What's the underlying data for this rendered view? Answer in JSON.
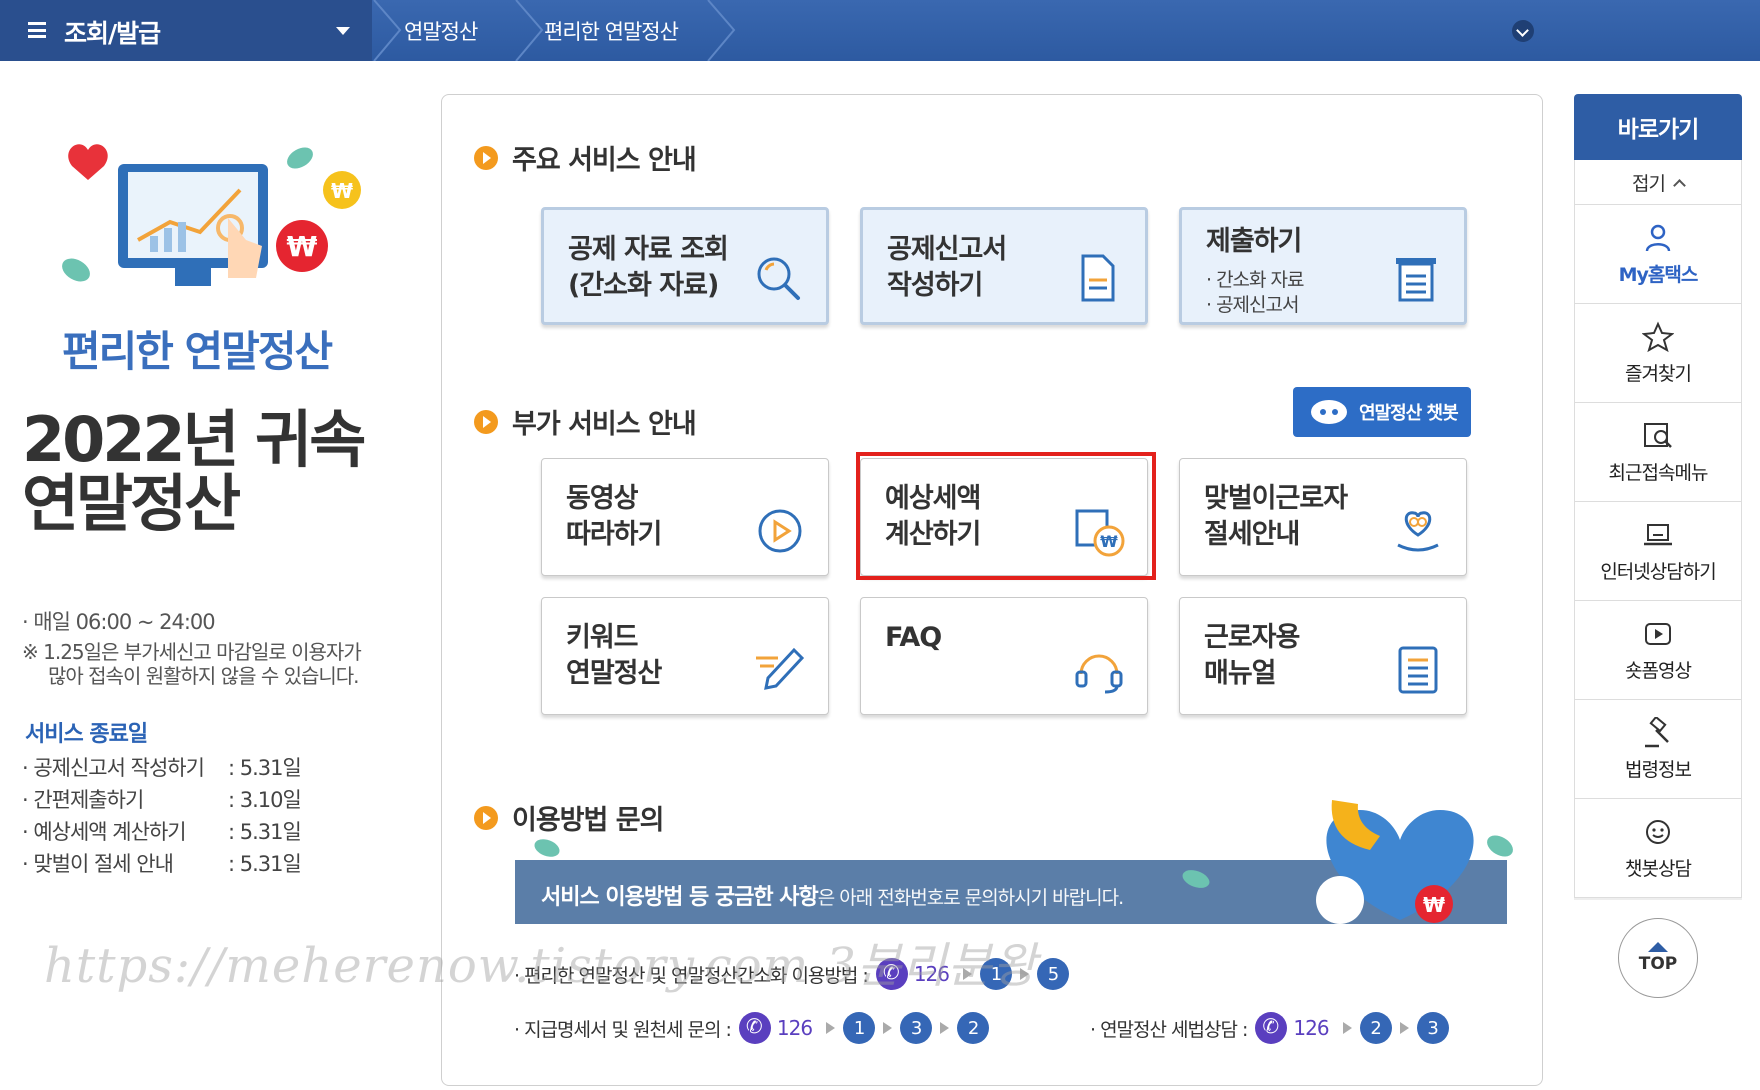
{
  "header": {
    "menu_title": "조회/발급",
    "breadcrumbs": [
      "연말정산",
      "편리한 연말정산"
    ]
  },
  "left": {
    "promo_title": "편리한 연말정산",
    "big_title_line1": "2022년 귀속",
    "big_title_line2": "연말정산",
    "hours": "· 매일 06:00  ~ 24:00",
    "notice_line1": "※ 1.25일은 부가세신고 마감일로 이용자가",
    "notice_line2": "많아 접속이 원활하지 않을 수 있습니다.",
    "end_title": "서비스 종료일",
    "end_items": [
      {
        "name": "· 공제신고서 작성하기",
        "date": ": 5.31일"
      },
      {
        "name": "· 간편제출하기",
        "date": ": 3.10일"
      },
      {
        "name": "· 예상세액 계산하기",
        "date": ": 5.31일"
      },
      {
        "name": "· 맞벌이 절세 안내",
        "date": ": 5.31일"
      }
    ]
  },
  "watermark": "https://meherenow.tistory.com 3분리분왕",
  "main": {
    "section1_title": "주요 서비스 안내",
    "main_cards": [
      {
        "label": "공제 자료 조회\n(간소화 자료)",
        "icon": "search-icon"
      },
      {
        "label": "공제신고서\n작성하기",
        "icon": "document-icon"
      },
      {
        "label": "제출하기",
        "sub1": "· 간소화 자료",
        "sub2": "· 공제신고서",
        "icon": "submit-tray-icon"
      }
    ],
    "section2_title": "부가 서비스 안내",
    "chatbot_label": "연말정산 챗봇",
    "extra_cards": [
      {
        "label": "동영상\n따라하기",
        "icon": "play-icon"
      },
      {
        "label": "예상세액\n계산하기",
        "icon": "calculator-won-icon"
      },
      {
        "label": "맞벌이근로자\n절세안내",
        "icon": "heart-hand-icon"
      },
      {
        "label": "키워드\n연말정산",
        "icon": "pencil-icon"
      },
      {
        "label": "FAQ",
        "icon": "headset-icon"
      },
      {
        "label": "근로자용\n매뉴얼",
        "icon": "manual-icon"
      }
    ],
    "section3_title": "이용방법 문의",
    "banner_bold": "서비스 이용방법 등 궁금한 사항",
    "banner_rest": "은 아래 전화번호로 문의하시기 바랍니다.",
    "phone_rows": [
      {
        "label": "· 편리한 연말정산 및 연말정산간소화 이용방법 :",
        "number": "126",
        "steps": [
          "1",
          "5"
        ]
      },
      {
        "label": "· 지급명세서 및 원천세 문의 :",
        "number": "126",
        "steps": [
          "1",
          "3",
          "2"
        ]
      },
      {
        "label": "· 연말정산 세법상담 :",
        "number": "126",
        "steps": [
          "2",
          "3"
        ]
      }
    ]
  },
  "sidebar": {
    "head": "바로가기",
    "fold": "접기",
    "items": [
      {
        "label": "My홈택스",
        "icon": "person-icon"
      },
      {
        "label": "즐겨찾기",
        "icon": "star-icon"
      },
      {
        "label": "최근접속메뉴",
        "icon": "recent-search-icon"
      },
      {
        "label": "인터넷상담하기",
        "icon": "laptop-icon"
      },
      {
        "label": "숏폼영상",
        "icon": "video-icon"
      },
      {
        "label": "법령정보",
        "icon": "gavel-icon"
      },
      {
        "label": "챗봇상담",
        "icon": "chatbot-icon"
      }
    ],
    "top": "TOP"
  },
  "colors": {
    "header_blue": "#2d5aa1",
    "accent_orange": "#f39a1e",
    "highlight_red": "#e3211c",
    "phone_purple": "#5a3fbf"
  }
}
